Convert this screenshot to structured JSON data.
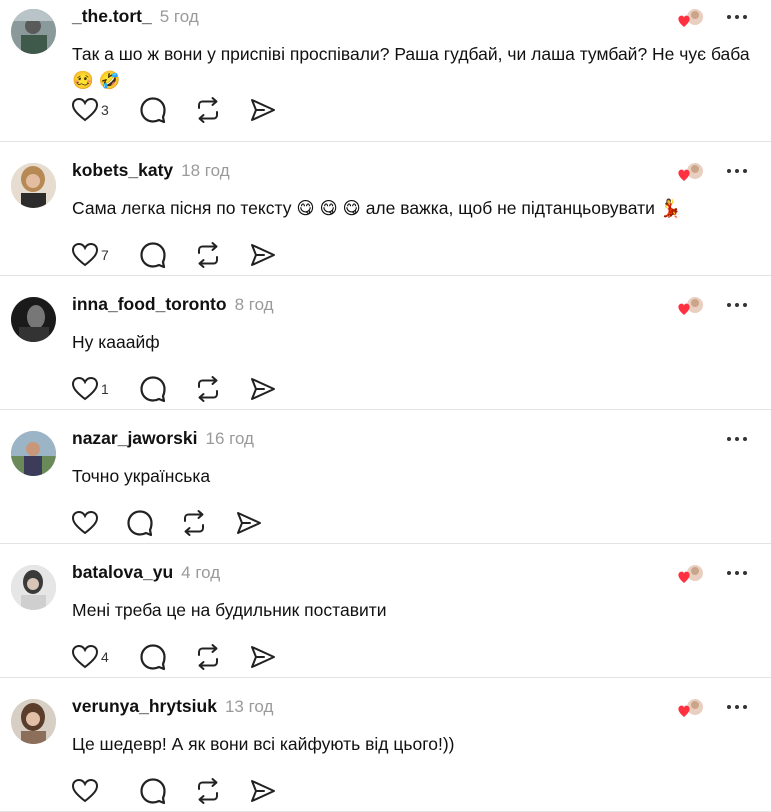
{
  "posts": [
    {
      "username": "_the.tort_",
      "time": "5 год",
      "text": "Так а шо ж вони у приспіві проспівали? Раша гудбай, чи лаша тумбай? Не чує баба",
      "emoji": "🥴 🤣",
      "likes": "3",
      "liked_by_author": true
    },
    {
      "username": "kobets_katy",
      "time": "18 год",
      "text": "Сама легка пісня по тексту",
      "emoji_mid": "😋 😋 😋",
      "text_after": "але важка, щоб не підтанцьовувати",
      "emoji_end": "💃",
      "likes": "7",
      "liked_by_author": true
    },
    {
      "username": "inna_food_toronto",
      "time": "8 год",
      "text": "Ну кааайф",
      "likes": "1",
      "liked_by_author": true
    },
    {
      "username": "nazar_jaworski",
      "time": "16 год",
      "text": "Точно українська",
      "likes": "",
      "liked_by_author": false
    },
    {
      "username": "batalova_yu",
      "time": "4 год",
      "text": "Мені треба це на будильник поставити",
      "likes": "4",
      "liked_by_author": true
    },
    {
      "username": "verunya_hrytsiuk",
      "time": "13 год",
      "text": "Це шедевр! А як вони всі кайфують від цього!))",
      "likes": "",
      "liked_by_author": true
    }
  ],
  "icons": {
    "like": "heart-icon",
    "reply": "comment-icon",
    "repost": "repost-icon",
    "share": "send-icon",
    "more": "more-icon"
  },
  "colors": {
    "accent": "#ff3040",
    "muted": "#9a9a9a",
    "divider": "#e3e3e3"
  }
}
